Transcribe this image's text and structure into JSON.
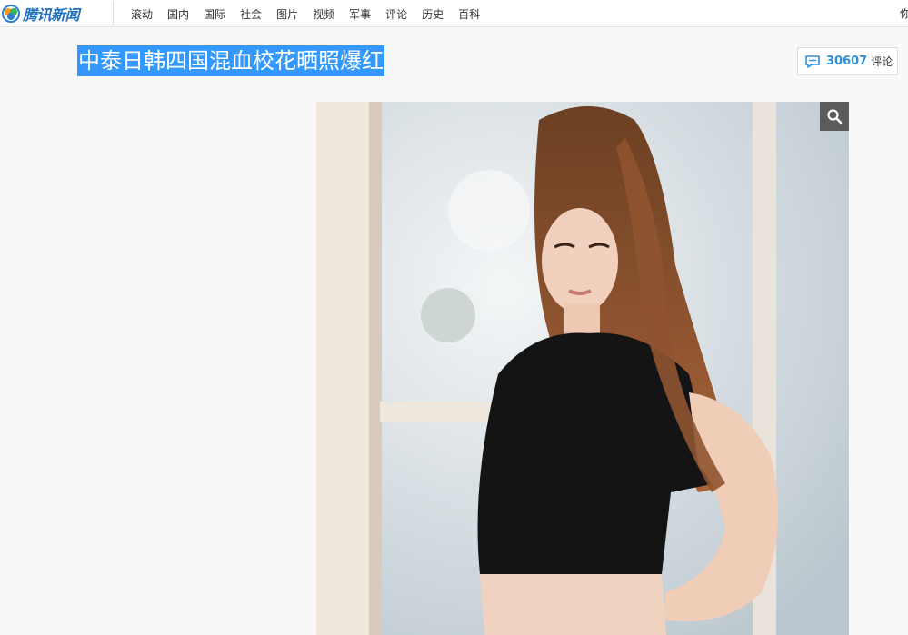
{
  "header": {
    "logo_text": "腾讯新闻",
    "nav": [
      "滚动",
      "国内",
      "国际",
      "社会",
      "图片",
      "视频",
      "军事",
      "评论",
      "历史",
      "百科"
    ],
    "right_text": "你"
  },
  "article": {
    "title": "中泰日韩四国混血校花晒照爆红",
    "comment_count": "30607",
    "comment_label": "评论"
  },
  "colors": {
    "accent": "#2f8fd9",
    "selection": "#3399ff"
  },
  "icons": [
    "tencent-news-logo-icon",
    "comment-bubble-icon",
    "magnifier-icon"
  ]
}
